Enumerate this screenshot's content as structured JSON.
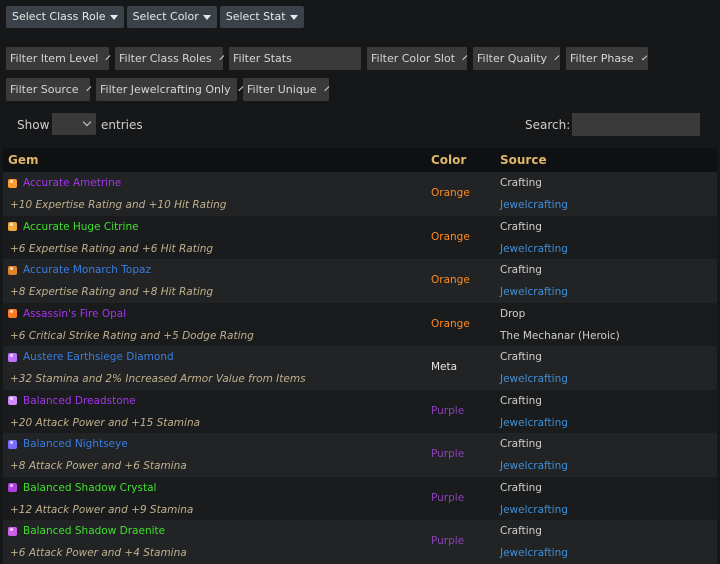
{
  "top_buttons": [
    "Select Class Role",
    "Select Color",
    "Select Stat"
  ],
  "filters_row1": [
    "Filter Item Level",
    "Filter Class Roles"
  ],
  "filter_stats_placeholder": "Filter Stats",
  "filters_row1_after": [
    "Filter Color Slot",
    "Filter Quality",
    "Filter Phase"
  ],
  "filters_row2": [
    "Filter Source",
    "Filter Jewelcrafting Only",
    "Filter Unique"
  ],
  "controls": {
    "show": "Show",
    "entries": "entries",
    "search": "Search:"
  },
  "columns": {
    "gem": "Gem",
    "color": "Color",
    "source": "Source"
  },
  "colors": {
    "quality_epic": "#a335ee",
    "quality_rare": "#3a7de0",
    "quality_uncommon": "#3fe030",
    "orange": "#ff8a1d",
    "purple": "#8a42b8",
    "meta": "#e6e6e6"
  },
  "rows": [
    {
      "name": "Accurate Ametrine",
      "quality": "epic",
      "icon": "orange-gem-icon",
      "icon_color": "#ff9b2a",
      "desc": "+10 Expertise Rating and +10 Hit Rating",
      "color": "Orange",
      "color_hex": "#ff8a1d",
      "source_type": "Crafting",
      "source_detail": "Jewelcrafting",
      "source_link": true
    },
    {
      "name": "Accurate Huge Citrine",
      "quality": "uncommon",
      "icon": "orange-gem-icon",
      "icon_color": "#f0a83a",
      "desc": "+6 Expertise Rating and +6 Hit Rating",
      "color": "Orange",
      "color_hex": "#ff8a1d",
      "source_type": "Crafting",
      "source_detail": "Jewelcrafting",
      "source_link": true
    },
    {
      "name": "Accurate Monarch Topaz",
      "quality": "rare",
      "icon": "orange-gem-icon",
      "icon_color": "#e0842a",
      "desc": "+8 Expertise Rating and +8 Hit Rating",
      "color": "Orange",
      "color_hex": "#ff8a1d",
      "source_type": "Crafting",
      "source_detail": "Jewelcrafting",
      "source_link": true
    },
    {
      "name": "Assassin's Fire Opal",
      "quality": "epic",
      "icon": "orange-gem-icon",
      "icon_color": "#ff7a22",
      "desc": "+6 Critical Strike Rating and +5 Dodge Rating",
      "color": "Orange",
      "color_hex": "#ff8a1d",
      "source_type": "Drop",
      "source_detail": "The Mechanar (Heroic)",
      "source_link": false
    },
    {
      "name": "Austere Earthsiege Diamond",
      "quality": "rare",
      "icon": "meta-gem-icon",
      "icon_color": "#c070ff",
      "desc": "+32 Stamina and 2% Increased Armor Value from Items",
      "color": "Meta",
      "color_hex": "#e6e6e6",
      "source_type": "Crafting",
      "source_detail": "Jewelcrafting",
      "source_link": true
    },
    {
      "name": "Balanced Dreadstone",
      "quality": "epic",
      "icon": "purple-gem-icon",
      "icon_color": "#d08cff",
      "desc": "+20 Attack Power and +15 Stamina",
      "color": "Purple",
      "color_hex": "#8a42b8",
      "source_type": "Crafting",
      "source_detail": "Jewelcrafting",
      "source_link": true
    },
    {
      "name": "Balanced Nightseye",
      "quality": "rare",
      "icon": "purple-gem-icon",
      "icon_color": "#7a6cff",
      "desc": "+8 Attack Power and +6 Stamina",
      "color": "Purple",
      "color_hex": "#8a42b8",
      "source_type": "Crafting",
      "source_detail": "Jewelcrafting",
      "source_link": true
    },
    {
      "name": "Balanced Shadow Crystal",
      "quality": "uncommon",
      "icon": "purple-gem-icon",
      "icon_color": "#b040e0",
      "desc": "+12 Attack Power and +9 Stamina",
      "color": "Purple",
      "color_hex": "#8a42b8",
      "source_type": "Crafting",
      "source_detail": "Jewelcrafting",
      "source_link": true
    },
    {
      "name": "Balanced Shadow Draenite",
      "quality": "uncommon",
      "icon": "purple-gem-icon",
      "icon_color": "#d060e8",
      "desc": "+6 Attack Power and +4 Stamina",
      "color": "Purple",
      "color_hex": "#8a42b8",
      "source_type": "Crafting",
      "source_detail": "Jewelcrafting",
      "source_link": true
    }
  ]
}
